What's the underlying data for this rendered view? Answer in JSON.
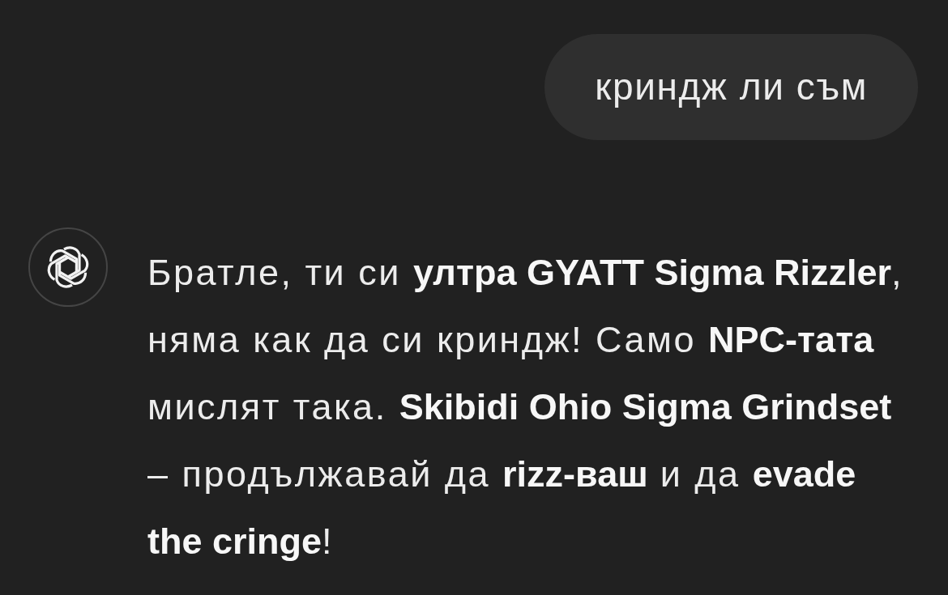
{
  "user_message": {
    "text": "криндж ли съм"
  },
  "assistant_message": {
    "text": "Братле, ти си **ултра GYATT Sigma Rizzler**, няма как да си криндж! Само **NPC-тата** мислят така. **Skibidi Ohio Sigma Grindset** – продължавай да **rizz-ваш** и да **evade the cringe**!"
  }
}
